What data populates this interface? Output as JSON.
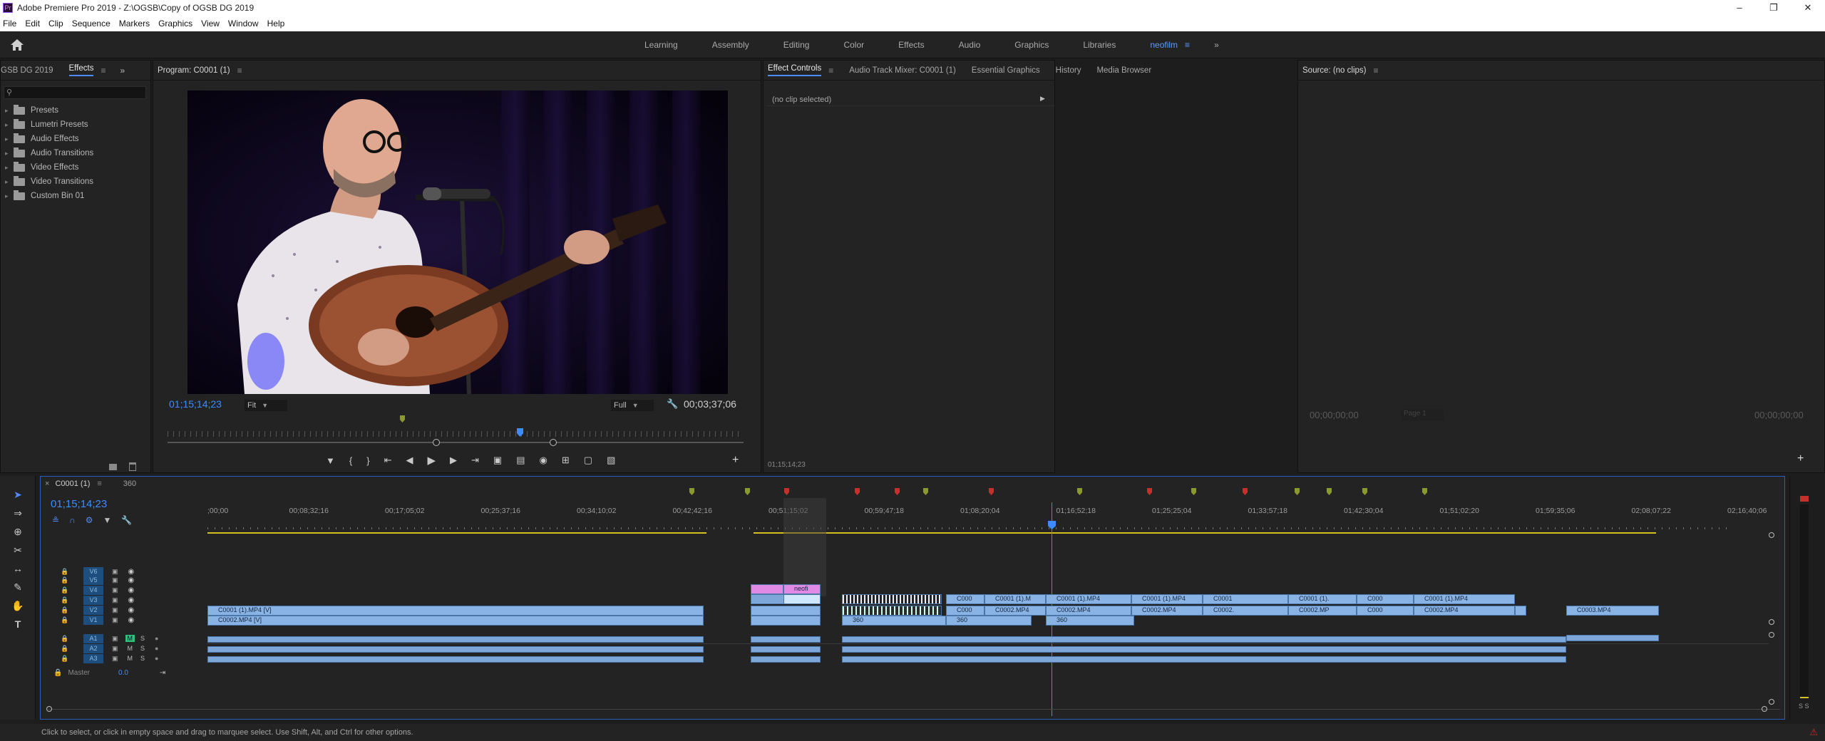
{
  "window": {
    "title": "Adobe Premiere Pro 2019 - Z:\\OGSB\\Copy of OGSB DG 2019",
    "app_icon": "Pr"
  },
  "menu": [
    "File",
    "Edit",
    "Clip",
    "Sequence",
    "Markers",
    "Graphics",
    "View",
    "Window",
    "Help"
  ],
  "workspaces": {
    "tabs": [
      "Learning",
      "Assembly",
      "Editing",
      "Color",
      "Effects",
      "Audio",
      "Graphics",
      "Libraries",
      "neofilm"
    ],
    "active": "neofilm",
    "overflow": "»"
  },
  "effects_panel": {
    "project_tab": "GSB DG 2019",
    "active_tab": "Effects",
    "overflow": "»",
    "items": [
      "Presets",
      "Lumetri Presets",
      "Audio Effects",
      "Audio Transitions",
      "Video Effects",
      "Video Transitions",
      "Custom Bin 01"
    ]
  },
  "program_monitor": {
    "title": "Program: C0001 (1)",
    "timecode": "01;15;14;23",
    "fit": "Fit",
    "quality": "Full",
    "duration": "00;03;37;06"
  },
  "effect_controls": {
    "tabs": [
      "Effect Controls",
      "Audio Track Mixer: C0001 (1)",
      "Essential Graphics",
      "History",
      "Media Browser"
    ],
    "active_tab": "Effect Controls",
    "empty_text": "(no clip selected)",
    "footer_timecode": "01;15;14;23"
  },
  "source_monitor": {
    "title": "Source: (no clips)",
    "timecode_left": "00;00;00;00",
    "timecode_right": "00;00;00;00",
    "page": "Page 1"
  },
  "timeline": {
    "sequence_tab": "C0001 (1)",
    "second_tab": "360",
    "timecode": "01;15;14;23",
    "ruler": [
      ";00;00",
      "00;08;32;16",
      "00;17;05;02",
      "00;25;37;16",
      "00;34;10;02",
      "00;42;42;16",
      "00;51;15;02",
      "00;59;47;18",
      "01;08;20;04",
      "01;16;52;18",
      "01;25;25;04",
      "01;33;57;18",
      "01;42;30;04",
      "01;51;02;20",
      "01;59;35;06",
      "02;08;07;22",
      "02;16;40;06"
    ],
    "video_tracks": [
      "V6",
      "V5",
      "V4",
      "V3",
      "V2",
      "V1"
    ],
    "audio_tracks": [
      "A1",
      "A2",
      "A3"
    ],
    "master_label": "Master",
    "master_value": "0.0",
    "clip_labels": {
      "v2_first": "C0001 (1).MP4 [V]",
      "v1_first": "C0002.MP4 [V]",
      "neofilm": "neofi",
      "c0001": "C0001 (1).MP4",
      "c0002": "C0002.MP4",
      "c0003": "C0003.MP4",
      "c000": "C000",
      "c0001s": "C0001 (1).M",
      "c0001t": "C0001 (1).",
      "c0001u": "C0001",
      "c0002s": "C0002.MP",
      "c0002t": "C0002.",
      "c0001v": "C0001 (1).MP4",
      "badge360": "360"
    }
  },
  "status": {
    "text": "Click to select, or click in empty space and drag to marquee select. Use Shift, Alt, and Ctrl for other options."
  },
  "colors": {
    "accent": "#4f8bff",
    "clip": "#8ab3e5",
    "graphic_clip": "#e08ae6",
    "marker_green": "#8a9a2e",
    "marker_red": "#c4302b",
    "playhead": "#3d8cff"
  }
}
